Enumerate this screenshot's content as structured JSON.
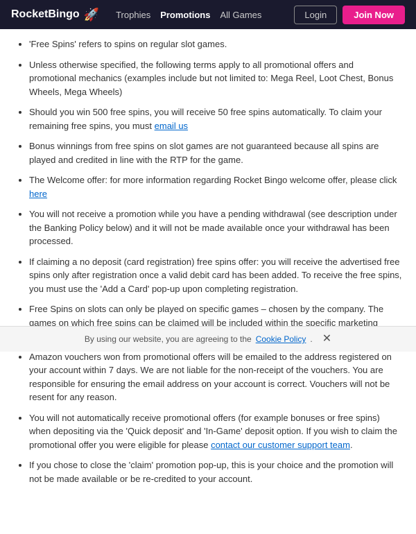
{
  "header": {
    "logo_text": "RocketBingo",
    "rocket_symbol": "🚀",
    "nav": [
      {
        "label": "Trophies",
        "active": false
      },
      {
        "label": "Promotions",
        "active": true
      },
      {
        "label": "All Games",
        "active": false
      }
    ],
    "login_label": "Login",
    "join_label": "Join Now"
  },
  "content": {
    "items": [
      {
        "text": "'Free Spins' refers to spins on regular slot games.",
        "has_link": false
      },
      {
        "text": "Unless otherwise specified, the following terms apply to all promotional offers and promotional mechanics (examples include but not limited to: Mega Reel, Loot Chest, Bonus Wheels, Mega Wheels)",
        "has_link": false
      },
      {
        "text_before": "Should you win 500 free spins, you will receive 50 free spins automatically. To claim your remaining free spins, you must ",
        "link_text": "email us",
        "text_after": "",
        "has_link": true
      },
      {
        "text": "Bonus winnings from free spins on slot games are not guaranteed because all spins are played and credited in line with the RTP for the game.",
        "has_link": false
      },
      {
        "text_before": "The Welcome offer: for more information regarding Rocket Bingo welcome offer, please click ",
        "link_text": "here",
        "text_after": "",
        "has_link": true
      },
      {
        "text": "You will not receive a promotion while you have a pending withdrawal (see description under the Banking Policy below) and it will not be made available once your withdrawal has been processed.",
        "has_link": false
      },
      {
        "text": "If claiming a no deposit (card registration) free spins offer: you will receive the advertised free spins only after registration once a valid debit card has been added. To receive the free spins, you must use the 'Add a Card' pop-up upon completing registration.",
        "has_link": false
      },
      {
        "text": "Free Spins on slots can only be played on specific games – chosen by the company. The games on which free spins can be claimed will be included within the specific marketing material for the offer.",
        "has_link": false
      },
      {
        "text": "Amazon vouchers won from promotional offers will be emailed to the address registered on your account within 7 days. We are not liable for the non-receipt of the vouchers. You are responsible for ensuring the email address on your account is correct. Vouchers will not be resent for any reason.",
        "has_link": false
      },
      {
        "text_before": "You will not automatically receive promotional offers (for example bonuses or free spins) when depositing via the 'Quick deposit' and 'In-Game' deposit option. If you wish to claim the promotional offer you were eligible for please ",
        "link_text": "contact our customer support team",
        "text_after": ".",
        "has_link": true
      },
      {
        "text": "If you chose to close the 'claim' promotion pop-up, this is your choice and the promotion will not be made available or be re-credited to your account.",
        "has_link": false
      }
    ]
  },
  "cookie_bar": {
    "text_before": "By using our website, you are agreeing to the ",
    "link_text": "Cookie Policy",
    "text_after": ".",
    "close_symbol": "✕"
  }
}
